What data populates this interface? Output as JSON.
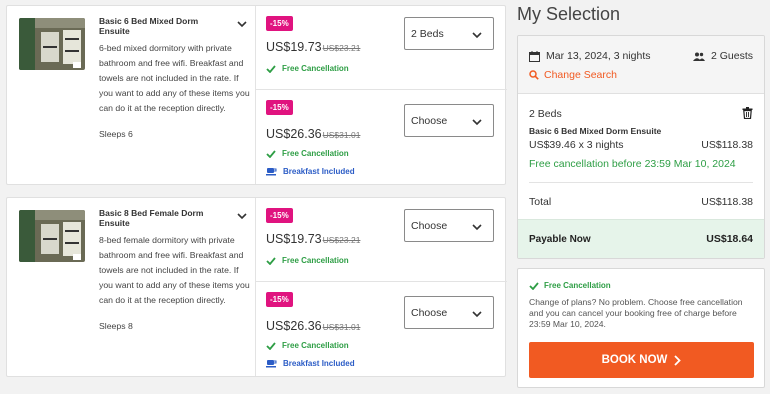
{
  "rooms": [
    {
      "title": "Basic 6 Bed Mixed Dorm Ensuite",
      "description": "6-bed mixed dormitory with private bathroom and free wifi. Breakfast and towels are not included in the rate. If you want to add any of these items you can do it at the reception directly.",
      "sleeps": "Sleeps 6",
      "rates": [
        {
          "discount": "-15%",
          "price": "US$19.73",
          "old_price": "US$23.21",
          "features": [
            "Free Cancellation"
          ],
          "selected": "2 Beds"
        },
        {
          "discount": "-15%",
          "price": "US$26.36",
          "old_price": "US$31.01",
          "features": [
            "Free Cancellation",
            "Breakfast Included"
          ],
          "selected": "Choose"
        }
      ]
    },
    {
      "title": "Basic 8 Bed Female Dorm Ensuite",
      "description": "8-bed female dormitory with private bathroom and free wifi. Breakfast and towels are not included in the rate. If you want to add any of these items you can do it at the reception directly.",
      "sleeps": "Sleeps 8",
      "rates": [
        {
          "discount": "-15%",
          "price": "US$19.73",
          "old_price": "US$23.21",
          "features": [
            "Free Cancellation"
          ],
          "selected": "Choose"
        },
        {
          "discount": "-15%",
          "price": "US$26.36",
          "old_price": "US$31.01",
          "features": [
            "Free Cancellation",
            "Breakfast Included"
          ],
          "selected": "Choose"
        }
      ]
    }
  ],
  "selection": {
    "title": "My Selection",
    "date": "Mar 13, 2024, 3 nights",
    "guests": "2 Guests",
    "change_search": "Change Search",
    "beds": "2 Beds",
    "room_name": "Basic 6 Bed Mixed Dorm Ensuite",
    "calc": "US$39.46 x 3 nights",
    "calc_total": "US$118.38",
    "free_until": "Free cancellation before 23:59 Mar 10, 2024",
    "total_label": "Total",
    "total_value": "US$118.38",
    "payable_label": "Payable Now",
    "payable_value": "US$18.64"
  },
  "cancellation": {
    "title": "Free Cancellation",
    "text": "Change of plans? No problem. Choose free cancellation and you can cancel your booking free of charge before 23:59 Mar 10, 2024.",
    "book_label": "BOOK NOW"
  },
  "colors": {
    "accent": "#f15a22",
    "discount": "#e0137f",
    "green": "#2e9e45",
    "blue": "#2b5cc6"
  },
  "icons": [
    "chevron-down-icon",
    "check-icon",
    "breakfast-cup-icon",
    "calendar-icon",
    "guests-icon",
    "search-icon",
    "trash-icon",
    "chevron-right-icon"
  ]
}
